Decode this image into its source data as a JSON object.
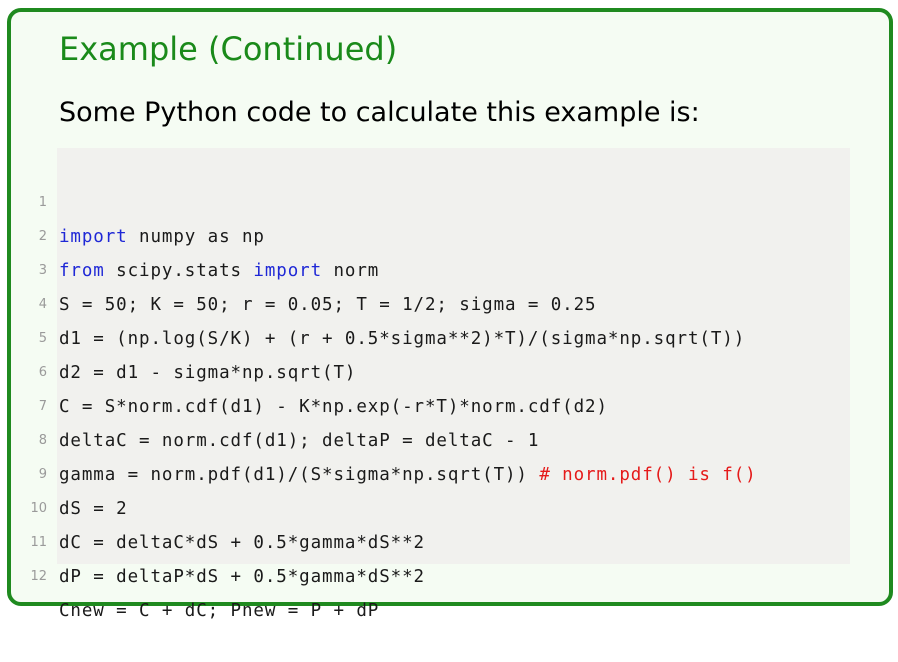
{
  "slide": {
    "title": "Example (Continued)",
    "intro": "Some Python code to calculate this example is:"
  },
  "code": {
    "colors": {
      "keyword": "#1f28d6",
      "comment": "#e51a1a",
      "text": "#1a1a1a",
      "line_number": "#9a9a9a",
      "background": "#f1f1ee",
      "frame": "#1f8a1f",
      "title": "#1a8a1a"
    },
    "lines": [
      {
        "num": "1",
        "kw1": "import",
        "t1": " numpy as np",
        "kw2": "",
        "t2": "",
        "comment": ""
      },
      {
        "num": "2",
        "kw1": "from",
        "t1": " scipy.stats ",
        "kw2": "import",
        "t2": " norm",
        "comment": ""
      },
      {
        "num": "3",
        "kw1": "",
        "t1": "S = 50; K = 50; r = 0.05; T = 1/2; sigma = 0.25",
        "kw2": "",
        "t2": "",
        "comment": ""
      },
      {
        "num": "4",
        "kw1": "",
        "t1": "d1 = (np.log(S/K) + (r + 0.5*sigma**2)*T)/(sigma*np.sqrt(T))",
        "kw2": "",
        "t2": "",
        "comment": ""
      },
      {
        "num": "5",
        "kw1": "",
        "t1": "d2 = d1 - sigma*np.sqrt(T)",
        "kw2": "",
        "t2": "",
        "comment": ""
      },
      {
        "num": "6",
        "kw1": "",
        "t1": "C = S*norm.cdf(d1) - K*np.exp(-r*T)*norm.cdf(d2)",
        "kw2": "",
        "t2": "",
        "comment": ""
      },
      {
        "num": "7",
        "kw1": "",
        "t1": "deltaC = norm.cdf(d1); deltaP = deltaC - 1",
        "kw2": "",
        "t2": "",
        "comment": ""
      },
      {
        "num": "8",
        "kw1": "",
        "t1": "gamma = norm.pdf(d1)/(S*sigma*np.sqrt(T)) ",
        "kw2": "",
        "t2": "",
        "comment": "# norm.pdf() is f()"
      },
      {
        "num": "9",
        "kw1": "",
        "t1": "dS = 2",
        "kw2": "",
        "t2": "",
        "comment": ""
      },
      {
        "num": "10",
        "kw1": "",
        "t1": "dC = deltaC*dS + 0.5*gamma*dS**2",
        "kw2": "",
        "t2": "",
        "comment": ""
      },
      {
        "num": "11",
        "kw1": "",
        "t1": "dP = deltaP*dS + 0.5*gamma*dS**2",
        "kw2": "",
        "t2": "",
        "comment": ""
      },
      {
        "num": "12",
        "kw1": "",
        "t1": "Cnew = C + dC; Pnew = P + dP",
        "kw2": "",
        "t2": "",
        "comment": ""
      }
    ]
  }
}
